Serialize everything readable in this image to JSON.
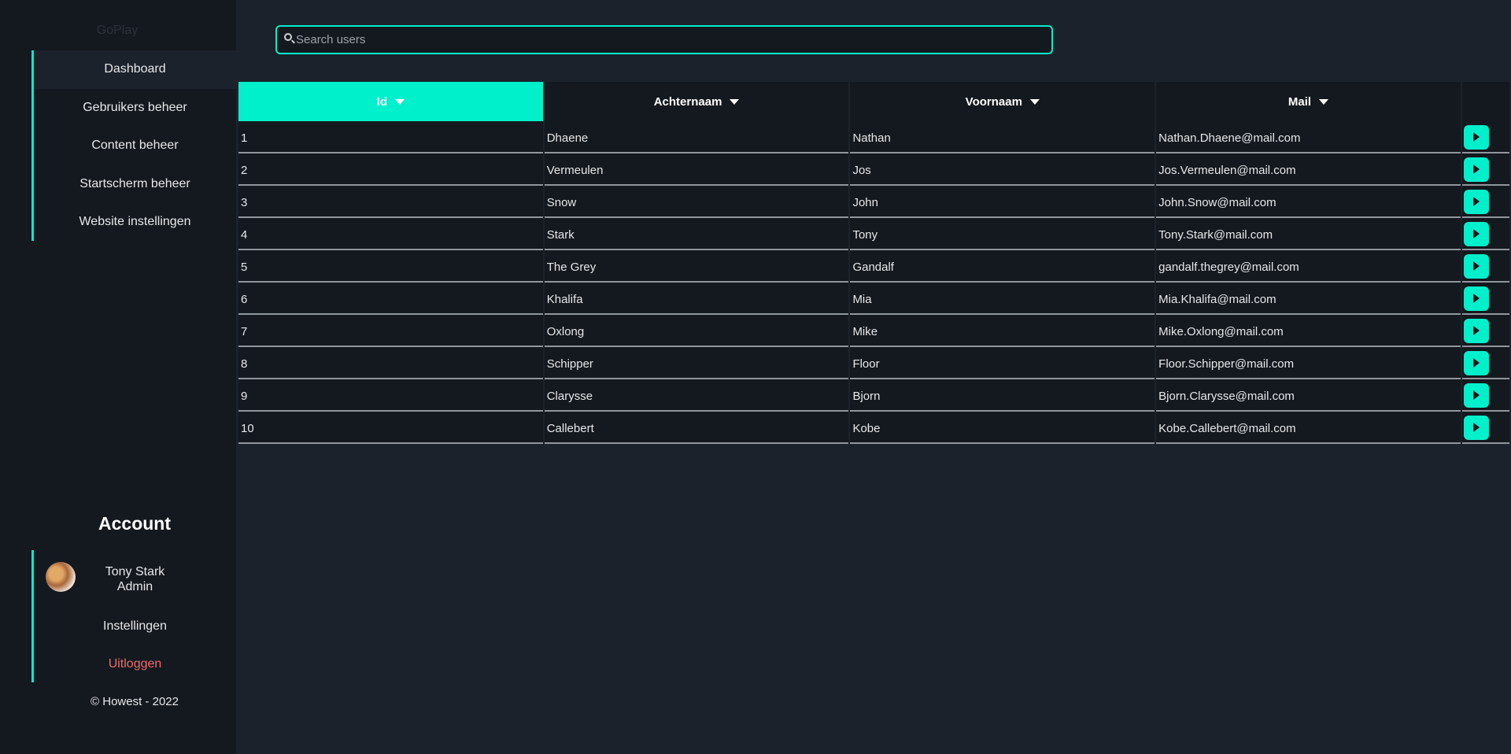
{
  "sidebar": {
    "logo": "GoPlay",
    "nav": [
      "Dashboard",
      "Gebruikers beheer",
      "Content beheer",
      "Startscherm beheer",
      "Website instellingen"
    ],
    "account_title": "Account",
    "user": {
      "name": "Tony Stark",
      "role": "Admin"
    },
    "settings": "Instellingen",
    "logout": "Uitloggen",
    "copyright": "© Howest - 2022"
  },
  "search": {
    "placeholder": "Search users"
  },
  "table": {
    "headers": [
      "Id",
      "Achternaam",
      "Voornaam",
      "Mail"
    ],
    "rows": [
      [
        "1",
        "Dhaene",
        "Nathan",
        "Nathan.Dhaene@mail.com"
      ],
      [
        "2",
        "Vermeulen",
        "Jos",
        "Jos.Vermeulen@mail.com"
      ],
      [
        "3",
        "Snow",
        "John",
        "John.Snow@mail.com"
      ],
      [
        "4",
        "Stark",
        "Tony",
        "Tony.Stark@mail.com"
      ],
      [
        "5",
        "The Grey",
        "Gandalf",
        "gandalf.thegrey@mail.com"
      ],
      [
        "6",
        "Khalifa",
        "Mia",
        "Mia.Khalifa@mail.com"
      ],
      [
        "7",
        "Oxlong",
        "Mike",
        "Mike.Oxlong@mail.com"
      ],
      [
        "8",
        "Schipper",
        "Floor",
        "Floor.Schipper@mail.com"
      ],
      [
        "9",
        "Clarysse",
        "Bjorn",
        "Bjorn.Clarysse@mail.com"
      ],
      [
        "10",
        "Callebert",
        "Kobe",
        "Kobe.Callebert@mail.com"
      ]
    ]
  },
  "colors": {
    "accent": "#00f0cc",
    "logout": "#f26b6b",
    "panel": "#14191f",
    "background": "#1b222b"
  }
}
